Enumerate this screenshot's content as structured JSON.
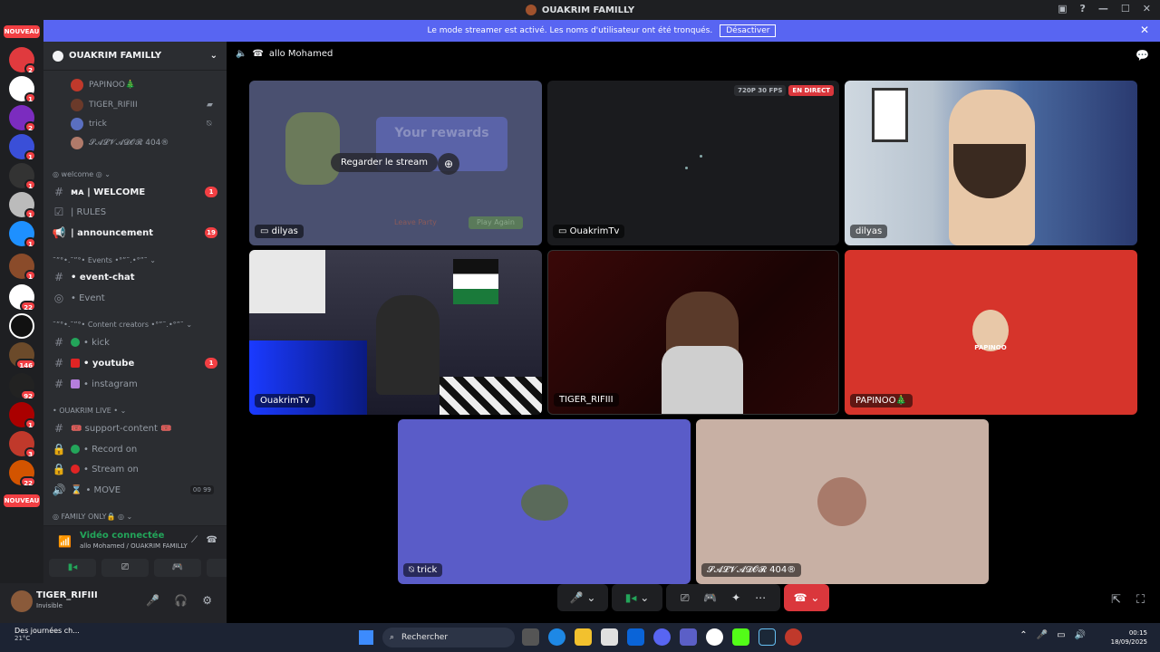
{
  "window": {
    "title": "OUAKRIM FAMILLY"
  },
  "banner": {
    "text": "Le mode streamer est activé. Les noms d'utilisateur ont été tronqués.",
    "button": "Désactiver"
  },
  "guild_badges": [
    "2",
    "1",
    "2",
    "1",
    "1",
    "1",
    "1",
    "1",
    "22",
    "146",
    "92",
    "1",
    "3",
    "22"
  ],
  "guild_new_label": "NOUVEAU",
  "server": {
    "name": "OUAKRIM FAMILLY"
  },
  "voice_members": [
    {
      "name": "PAPINOO🎄",
      "color": "#c0392b"
    },
    {
      "name": "TIGER_RIFIII",
      "color": "#6b3a2a"
    },
    {
      "name": "trick",
      "color": "#5a6fc0"
    },
    {
      "name": "𝓢𝓐𝓛𝓥𝓐𝓓𝓞𝓡 404®",
      "color": "#b07a6a"
    }
  ],
  "categories": {
    "welcome": "◎ welcome ◎ ⌄",
    "events": "˜”°•.˜”°• Events •°”˜.•°”˜ ⌄",
    "content": "˜”°•.˜”°• Content creators •°”˜.•°”˜ ⌄",
    "live": "• OUAKRIM LIVE • ⌄",
    "family": "◎ FAMILY ONLY🔒 ◎ ⌄"
  },
  "channels": {
    "welcome": {
      "label": "ᴍᴀ | WELCOME",
      "badge": "1"
    },
    "rules": {
      "label": "| RULES"
    },
    "announcement": {
      "label": "| announcement",
      "badge": "19"
    },
    "event_chat": {
      "label": "• event-chat"
    },
    "event": {
      "label": "• Event"
    },
    "kick": {
      "label": "• kick"
    },
    "youtube": {
      "label": "• youtube",
      "badge": "1"
    },
    "instagram": {
      "label": "• instagram"
    },
    "support": {
      "label": "🎟️ support-content 🎟️"
    },
    "record": {
      "label": "• Record on"
    },
    "stream": {
      "label": "• Stream on"
    },
    "move": {
      "label": "• MOVE",
      "counter_a": "00",
      "counter_b": "99"
    }
  },
  "voice_panel": {
    "status": "Vidéo connectée",
    "location": "allo Mohamed / OUAKRIM FAMILLY"
  },
  "user": {
    "name": "TIGER_RIFIII",
    "status": "Invisible"
  },
  "stage": {
    "channel": "allo Mohamed"
  },
  "tiles": [
    {
      "label": "dilyas",
      "overlay_button": "Regarder le stream",
      "bg_text_rewards": "Your rewards",
      "bg_text_leave": "Leave Party",
      "bg_text_play": "Play Again"
    },
    {
      "label": "OuakrimTv",
      "quality": "720P 30 FPS",
      "live": "EN DIRECT"
    },
    {
      "label": "dilyas"
    },
    {
      "label": "OuakrimTv"
    },
    {
      "label": "TIGER_RIFIII"
    },
    {
      "label": "PAPINOO🎄",
      "avatar_text": "PAPINOO"
    },
    {
      "label": "trick"
    },
    {
      "label": "𝓢𝓐𝓛𝓥𝓐𝓓𝓞𝓡 404®"
    }
  ],
  "taskbar": {
    "weather_title": "Des journées ch...",
    "weather_temp": "21°C",
    "search": "Rechercher",
    "time": "00:15",
    "date": "18/09/2025"
  }
}
